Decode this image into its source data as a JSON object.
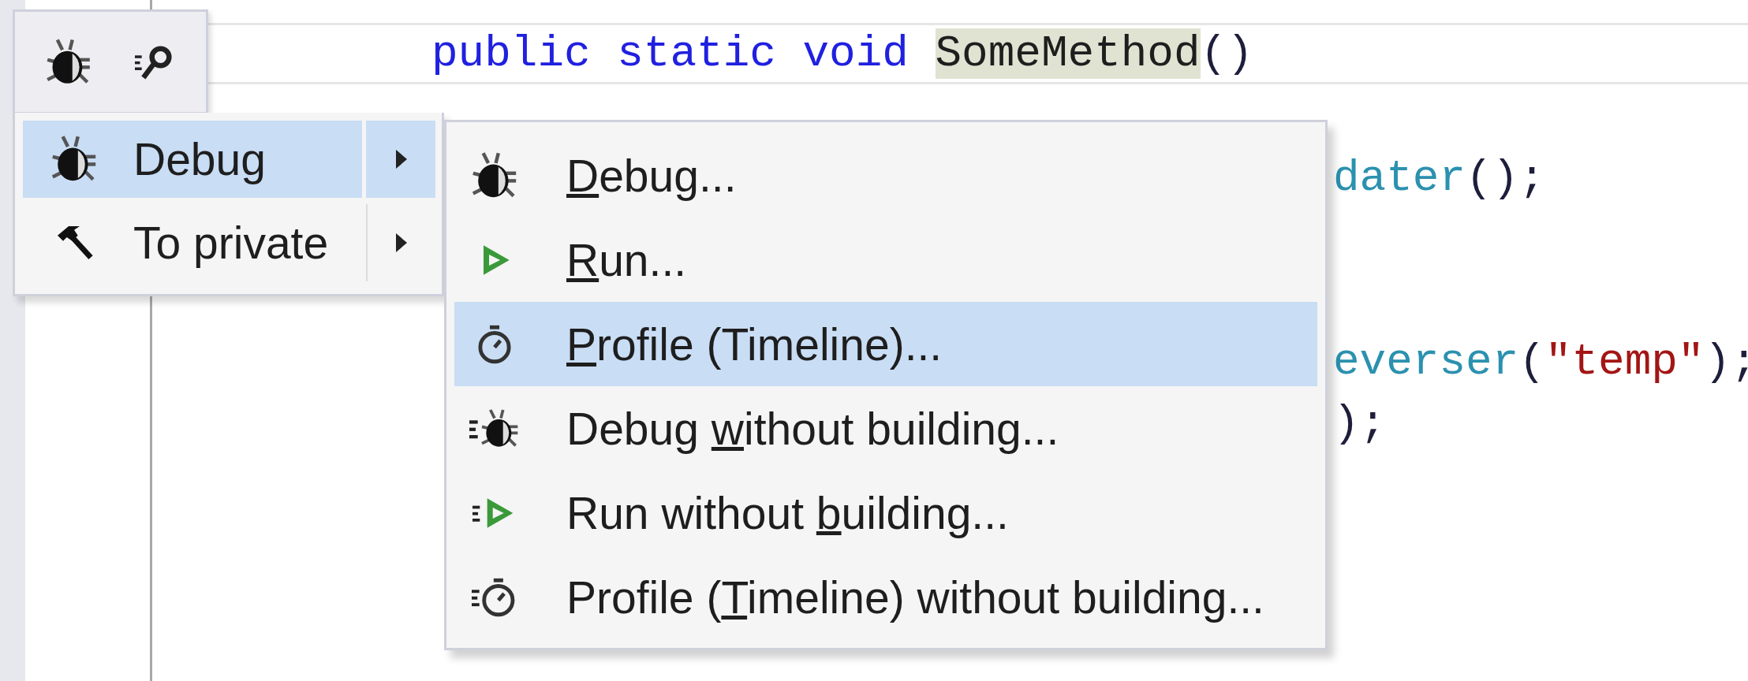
{
  "editor": {
    "lines": [
      {
        "current": true,
        "tokens": [
          {
            "text": "public static void ",
            "kind": "keyword"
          },
          {
            "text": "SomeMethod",
            "kind": "match"
          },
          {
            "text": "()",
            "kind": "punct"
          }
        ]
      },
      {
        "current": false,
        "tokens": [
          {
            "text": "dater",
            "kind": "type"
          },
          {
            "text": "();",
            "kind": "punct"
          }
        ]
      },
      {
        "current": false,
        "tokens": [
          {
            "text": "everser",
            "kind": "type"
          },
          {
            "text": "(",
            "kind": "punct"
          },
          {
            "text": "\"temp\"",
            "kind": "string"
          },
          {
            "text": ");",
            "kind": "punct"
          }
        ]
      },
      {
        "current": false,
        "tokens": [
          {
            "text": ");",
            "kind": "punct"
          }
        ]
      }
    ]
  },
  "context_menu": {
    "items": [
      {
        "label": "Debug",
        "selected": true,
        "submenu": true
      },
      {
        "label": "To private",
        "selected": false,
        "submenu": true
      }
    ]
  },
  "submenu": {
    "items": [
      {
        "access_key": "D",
        "after": "ebug...",
        "selected": false
      },
      {
        "access_key": "R",
        "after": "un...",
        "selected": false
      },
      {
        "access_key": "P",
        "after": "rofile (Timeline)...",
        "selected": true
      },
      {
        "before": "Debug ",
        "access_key": "w",
        "after": "ithout building...",
        "selected": false
      },
      {
        "before": "Run without ",
        "access_key": "b",
        "after": "uilding...",
        "selected": false
      },
      {
        "before": "Profile (",
        "access_key": "T",
        "after": "imeline) without building...",
        "selected": false
      }
    ]
  }
}
